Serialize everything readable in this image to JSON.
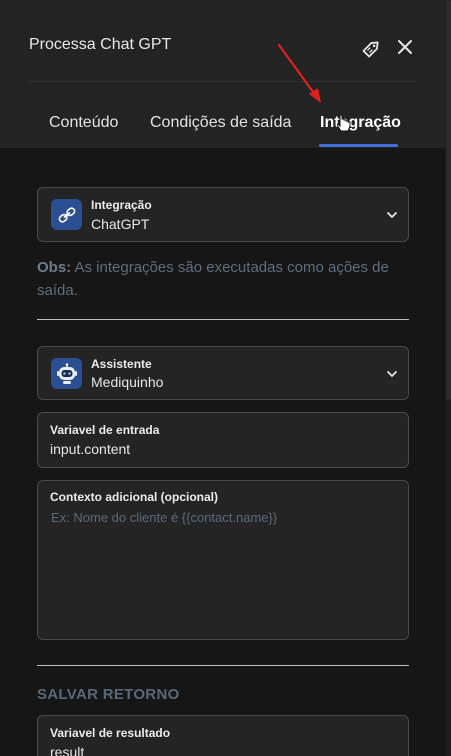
{
  "header": {
    "title": "Processa Chat GPT",
    "tag_icon": "tag-icon",
    "close_icon": "close-icon"
  },
  "tabs": [
    {
      "label": "Conteúdo",
      "active": false
    },
    {
      "label": "Condições de saída",
      "active": false
    },
    {
      "label": "Integração",
      "active": true
    }
  ],
  "integration": {
    "label": "Integração",
    "value": "ChatGPT",
    "icon": "link-icon"
  },
  "obs": {
    "prefix": "Obs:",
    "text": " As integrações são executadas como ações de saída."
  },
  "assistant": {
    "label": "Assistente",
    "value": "Mediquinho",
    "icon": "robot-icon"
  },
  "input_variable": {
    "label": "Variavel de entrada",
    "value": "input.content"
  },
  "context": {
    "label": "Contexto adicional (opcional)",
    "placeholder": "Ex: Nome do cliente é {{contact.name}}"
  },
  "save_section": {
    "title": "SALVAR RETORNO"
  },
  "result_variable": {
    "label": "Variavel de resultado",
    "value": "result"
  },
  "colors": {
    "accent": "#3e6fd8",
    "icon_bg": "#2c4f93",
    "annotation_arrow": "#e02020"
  }
}
